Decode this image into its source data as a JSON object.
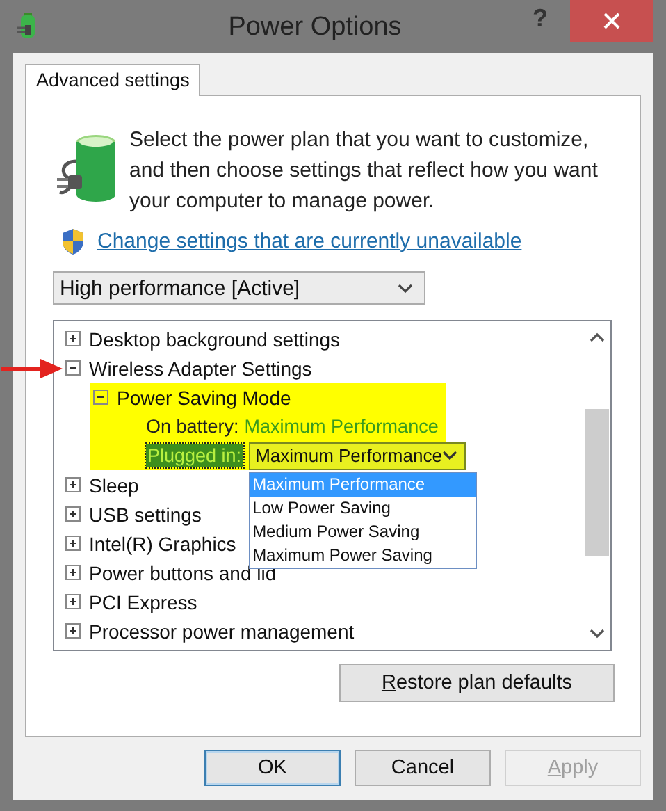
{
  "window": {
    "title": "Power Options",
    "help": "?"
  },
  "tabs": [
    {
      "label": "Advanced settings",
      "selected": true
    }
  ],
  "intro": "Select the power plan that you want to customize, and then choose settings that reflect how you want your computer to manage power.",
  "link": "Change settings that are currently unavailable",
  "plan": {
    "value": "High performance [Active]"
  },
  "tree": {
    "items": [
      {
        "label": "Desktop background settings",
        "expanded": false
      },
      {
        "label": "Wireless Adapter Settings",
        "expanded": true,
        "arrow": true,
        "children": [
          {
            "label": "Power Saving Mode",
            "expanded": true,
            "highlighted": true,
            "settings": [
              {
                "kind": "text",
                "label": "On battery:",
                "value": "Maximum Performance"
              },
              {
                "kind": "dropdown",
                "label": "Plugged in:",
                "value": "Maximum Performance",
                "focused": true,
                "options": [
                  {
                    "label": "Maximum Performance",
                    "selected": true
                  },
                  {
                    "label": "Low Power Saving",
                    "selected": false
                  },
                  {
                    "label": "Medium Power Saving",
                    "selected": false
                  },
                  {
                    "label": "Maximum Power Saving",
                    "selected": false
                  }
                ]
              }
            ]
          }
        ]
      },
      {
        "label": "Sleep",
        "expanded": false
      },
      {
        "label": "USB settings",
        "expanded": false
      },
      {
        "label": "Intel(R) Graphics",
        "expanded": false
      },
      {
        "label": "Power buttons and lid",
        "expanded": false
      },
      {
        "label": "PCI Express",
        "expanded": false
      },
      {
        "label": "Processor power management",
        "expanded": false
      }
    ]
  },
  "restore_button": {
    "label": "Restore plan defaults",
    "underline_first": true,
    "disabled": false
  },
  "buttons": [
    {
      "label": "OK",
      "default": true,
      "disabled": false,
      "underline_first": false
    },
    {
      "label": "Cancel",
      "default": false,
      "disabled": false,
      "underline_first": false
    },
    {
      "label": "Apply",
      "default": false,
      "disabled": true,
      "underline_first": true
    }
  ]
}
